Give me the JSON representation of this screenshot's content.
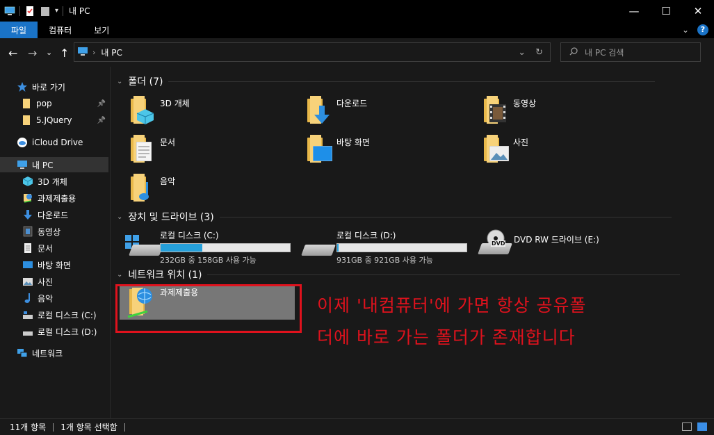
{
  "window": {
    "title": "내 PC",
    "minimize": "—",
    "maximize": "☐",
    "close": "✕"
  },
  "ribbon": {
    "tabs": [
      "파일",
      "컴퓨터",
      "보기"
    ],
    "collapse": "⌄",
    "help": "?"
  },
  "address": {
    "back": "←",
    "forward": "→",
    "recent": "⌄",
    "up": "↑",
    "path_sep": "›",
    "path": "내 PC",
    "dropdown": "⌄",
    "refresh": "↻",
    "search_placeholder": "내 PC 검색"
  },
  "sidebar": {
    "quick_access": "바로 가기",
    "pinned": [
      {
        "label": "pop",
        "pin": "📌"
      },
      {
        "label": "5.JQuery",
        "pin": "📌"
      }
    ],
    "icloud": "iCloud Drive",
    "this_pc": "내 PC",
    "pc_items": [
      "3D 개체",
      "과제제출용",
      "다운로드",
      "동영상",
      "문서",
      "바탕 화면",
      "사진",
      "음악",
      "로컬 디스크 (C:)",
      "로컬 디스크 (D:)"
    ],
    "network": "네트워크"
  },
  "groups": {
    "folders_header": "폴더 (7)",
    "drives_header": "장치 및 드라이브 (3)",
    "network_header": "네트워크 위치 (1)"
  },
  "folders": [
    "3D 개체",
    "다운로드",
    "동영상",
    "문서",
    "바탕 화면",
    "사진",
    "음악"
  ],
  "drives": [
    {
      "name": "로컬 디스크 (C:)",
      "size": "232GB 중 158GB 사용 가능",
      "used_fraction": 0.32
    },
    {
      "name": "로컬 디스크 (D:)",
      "size": "931GB 중 921GB 사용 가능",
      "used_fraction": 0.01
    },
    {
      "name": "DVD RW 드라이브 (E:)"
    }
  ],
  "network_location": "과제제출용",
  "annotation": {
    "line1": "이제 '내컴퓨터'에 가면 항상 공유폴",
    "line2": "더에 바로 가는 폴더가 존재합니다"
  },
  "status": {
    "count": "11개 항목",
    "selected": "1개 항목 선택함"
  },
  "colors": {
    "accent": "#1a73c7",
    "annotation": "#e0121d",
    "progress": "#26a0da",
    "folder": "#f7d27a"
  }
}
